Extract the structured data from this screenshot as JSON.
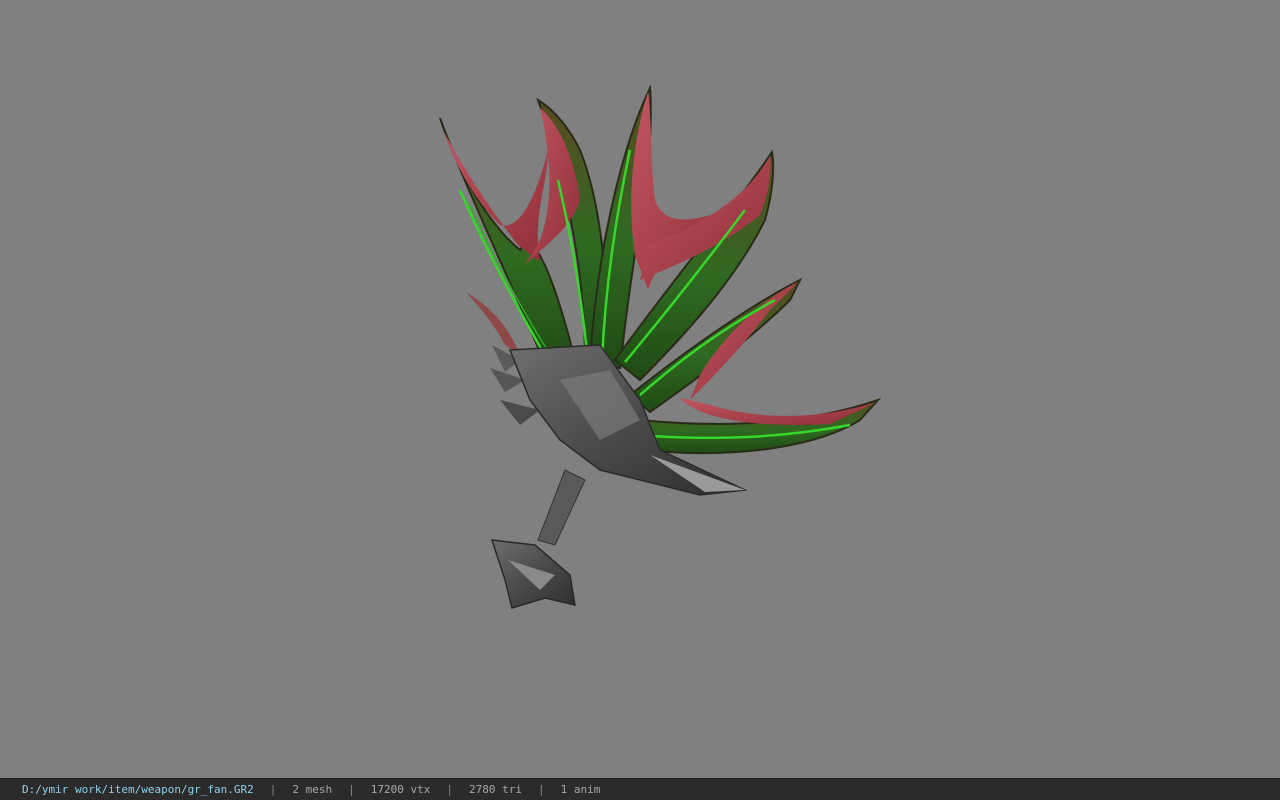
{
  "viewer": {
    "background_color": "#808080",
    "model_description_icon": "fan-weapon-model"
  },
  "status_bar": {
    "file_path": "D:/ymir work/item/weapon/gr_fan.GR2",
    "separator": "|",
    "mesh_count": "2 mesh",
    "vertex_count": "17200 vtx",
    "triangle_count": "2780 tri",
    "anim_count": "1 anim",
    "path_color": "#8fd0ea"
  }
}
